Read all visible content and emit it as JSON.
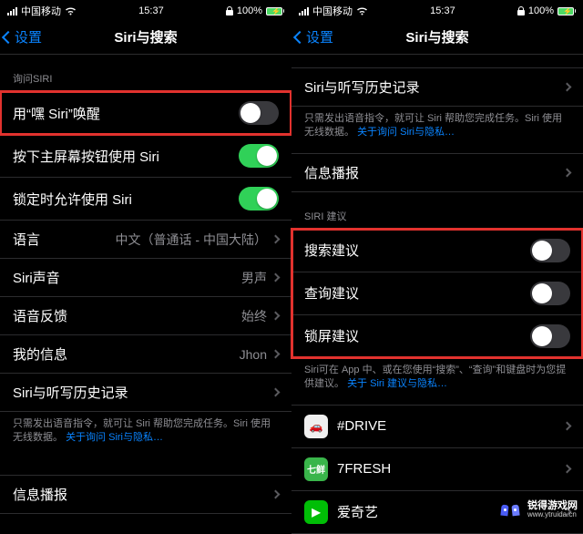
{
  "status": {
    "carrier": "中国移动",
    "time": "15:37",
    "battery": "100%"
  },
  "nav": {
    "back": "设置",
    "title": "Siri与搜索"
  },
  "left": {
    "section1": "询问SIRI",
    "hey_siri": "用“嘿 Siri”唤醒",
    "home_btn": "按下主屏幕按钮使用 Siri",
    "locked": "锁定时允许使用 Siri",
    "language_label": "语言",
    "language_value": "中文（普通话 - 中国大陆）",
    "voice_label": "Siri声音",
    "voice_value": "男声",
    "feedback_label": "语音反馈",
    "feedback_value": "始终",
    "myinfo_label": "我的信息",
    "myinfo_value": "Jhon",
    "history": "Siri与听写历史记录",
    "footer1a": "只需发出语音指令，就可让 Siri 帮助您完成任务。Siri 使用无线数据。",
    "footer1b": "关于询问 Siri与隐私…",
    "announce": "信息播报"
  },
  "right": {
    "history": "Siri与听写历史记录",
    "footer1a": "只需发出语音指令，就可让 Siri 帮助您完成任务。Siri 使用无线数据。",
    "footer1b": "关于询问 Siri与隐私…",
    "announce": "信息播报",
    "section2": "SIRI 建议",
    "search_sug": "搜索建议",
    "lookup_sug": "查询建议",
    "lock_sug": "锁屏建议",
    "footer2a": "Siri可在 App 中、或在您使用“搜索”、“查询”和键盘时为您提供建议。",
    "footer2b": "关于 Siri 建议与隐私…",
    "app1": "#DRIVE",
    "app2": "7FRESH",
    "app3": "爱奇艺"
  },
  "watermark": {
    "main": "锐得游戏网",
    "sub": "www.ytruida.cn"
  }
}
